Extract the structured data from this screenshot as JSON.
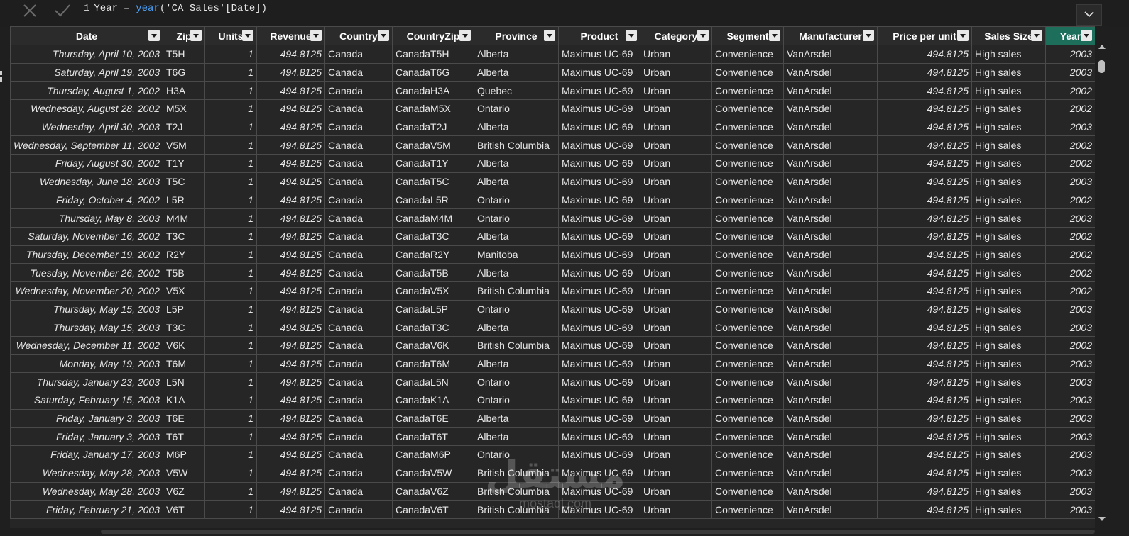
{
  "formula": {
    "line_number": "1",
    "prefix": "Year = ",
    "function": "year",
    "arg_open": "(",
    "argument": "'CA Sales'[Date]",
    "arg_close": ")"
  },
  "icons": {
    "cancel": "close-icon",
    "commit": "check-icon",
    "expand": "chevron-down-icon"
  },
  "colors": {
    "active_header": "#1e6e5c",
    "function_token": "#4aa3ff"
  },
  "watermark": {
    "big": "مستقل",
    "small": "mostaql.com"
  },
  "table": {
    "columns": [
      {
        "key": "date",
        "label": "Date",
        "align": "date"
      },
      {
        "key": "zip",
        "label": "Zip",
        "align": "txt"
      },
      {
        "key": "units",
        "label": "Units",
        "align": "num"
      },
      {
        "key": "revenue",
        "label": "Revenue",
        "align": "num"
      },
      {
        "key": "country",
        "label": "Country",
        "align": "txt"
      },
      {
        "key": "countryzip",
        "label": "CountryZip",
        "align": "txt"
      },
      {
        "key": "province",
        "label": "Province",
        "align": "txt"
      },
      {
        "key": "product",
        "label": "Product",
        "align": "txt"
      },
      {
        "key": "category",
        "label": "Category",
        "align": "txt"
      },
      {
        "key": "segment",
        "label": "Segment",
        "align": "txt"
      },
      {
        "key": "manufacturer",
        "label": "Manufacturer",
        "align": "txt"
      },
      {
        "key": "price",
        "label": "Price per unit",
        "align": "num"
      },
      {
        "key": "salessize",
        "label": "Sales Size",
        "align": "txt"
      },
      {
        "key": "year",
        "label": "Year",
        "align": "num",
        "active": true
      }
    ],
    "rows": [
      [
        "Thursday, April 10, 2003",
        "T5H",
        "1",
        "494.8125",
        "Canada",
        "CanadaT5H",
        "Alberta",
        "Maximus UC-69",
        "Urban",
        "Convenience",
        "VanArsdel",
        "494.8125",
        "High sales",
        "2003"
      ],
      [
        "Saturday, April 19, 2003",
        "T6G",
        "1",
        "494.8125",
        "Canada",
        "CanadaT6G",
        "Alberta",
        "Maximus UC-69",
        "Urban",
        "Convenience",
        "VanArsdel",
        "494.8125",
        "High sales",
        "2003"
      ],
      [
        "Thursday, August 1, 2002",
        "H3A",
        "1",
        "494.8125",
        "Canada",
        "CanadaH3A",
        "Quebec",
        "Maximus UC-69",
        "Urban",
        "Convenience",
        "VanArsdel",
        "494.8125",
        "High sales",
        "2002"
      ],
      [
        "Wednesday, August 28, 2002",
        "M5X",
        "1",
        "494.8125",
        "Canada",
        "CanadaM5X",
        "Ontario",
        "Maximus UC-69",
        "Urban",
        "Convenience",
        "VanArsdel",
        "494.8125",
        "High sales",
        "2002"
      ],
      [
        "Wednesday, April 30, 2003",
        "T2J",
        "1",
        "494.8125",
        "Canada",
        "CanadaT2J",
        "Alberta",
        "Maximus UC-69",
        "Urban",
        "Convenience",
        "VanArsdel",
        "494.8125",
        "High sales",
        "2003"
      ],
      [
        "Wednesday, September 11, 2002",
        "V5M",
        "1",
        "494.8125",
        "Canada",
        "CanadaV5M",
        "British Columbia",
        "Maximus UC-69",
        "Urban",
        "Convenience",
        "VanArsdel",
        "494.8125",
        "High sales",
        "2002"
      ],
      [
        "Friday, August 30, 2002",
        "T1Y",
        "1",
        "494.8125",
        "Canada",
        "CanadaT1Y",
        "Alberta",
        "Maximus UC-69",
        "Urban",
        "Convenience",
        "VanArsdel",
        "494.8125",
        "High sales",
        "2002"
      ],
      [
        "Wednesday, June 18, 2003",
        "T5C",
        "1",
        "494.8125",
        "Canada",
        "CanadaT5C",
        "Alberta",
        "Maximus UC-69",
        "Urban",
        "Convenience",
        "VanArsdel",
        "494.8125",
        "High sales",
        "2003"
      ],
      [
        "Friday, October 4, 2002",
        "L5R",
        "1",
        "494.8125",
        "Canada",
        "CanadaL5R",
        "Ontario",
        "Maximus UC-69",
        "Urban",
        "Convenience",
        "VanArsdel",
        "494.8125",
        "High sales",
        "2002"
      ],
      [
        "Thursday, May 8, 2003",
        "M4M",
        "1",
        "494.8125",
        "Canada",
        "CanadaM4M",
        "Ontario",
        "Maximus UC-69",
        "Urban",
        "Convenience",
        "VanArsdel",
        "494.8125",
        "High sales",
        "2003"
      ],
      [
        "Saturday, November 16, 2002",
        "T3C",
        "1",
        "494.8125",
        "Canada",
        "CanadaT3C",
        "Alberta",
        "Maximus UC-69",
        "Urban",
        "Convenience",
        "VanArsdel",
        "494.8125",
        "High sales",
        "2002"
      ],
      [
        "Thursday, December 19, 2002",
        "R2Y",
        "1",
        "494.8125",
        "Canada",
        "CanadaR2Y",
        "Manitoba",
        "Maximus UC-69",
        "Urban",
        "Convenience",
        "VanArsdel",
        "494.8125",
        "High sales",
        "2002"
      ],
      [
        "Tuesday, November 26, 2002",
        "T5B",
        "1",
        "494.8125",
        "Canada",
        "CanadaT5B",
        "Alberta",
        "Maximus UC-69",
        "Urban",
        "Convenience",
        "VanArsdel",
        "494.8125",
        "High sales",
        "2002"
      ],
      [
        "Wednesday, November 20, 2002",
        "V5X",
        "1",
        "494.8125",
        "Canada",
        "CanadaV5X",
        "British Columbia",
        "Maximus UC-69",
        "Urban",
        "Convenience",
        "VanArsdel",
        "494.8125",
        "High sales",
        "2002"
      ],
      [
        "Thursday, May 15, 2003",
        "L5P",
        "1",
        "494.8125",
        "Canada",
        "CanadaL5P",
        "Ontario",
        "Maximus UC-69",
        "Urban",
        "Convenience",
        "VanArsdel",
        "494.8125",
        "High sales",
        "2003"
      ],
      [
        "Thursday, May 15, 2003",
        "T3C",
        "1",
        "494.8125",
        "Canada",
        "CanadaT3C",
        "Alberta",
        "Maximus UC-69",
        "Urban",
        "Convenience",
        "VanArsdel",
        "494.8125",
        "High sales",
        "2003"
      ],
      [
        "Wednesday, December 11, 2002",
        "V6K",
        "1",
        "494.8125",
        "Canada",
        "CanadaV6K",
        "British Columbia",
        "Maximus UC-69",
        "Urban",
        "Convenience",
        "VanArsdel",
        "494.8125",
        "High sales",
        "2002"
      ],
      [
        "Monday, May 19, 2003",
        "T6M",
        "1",
        "494.8125",
        "Canada",
        "CanadaT6M",
        "Alberta",
        "Maximus UC-69",
        "Urban",
        "Convenience",
        "VanArsdel",
        "494.8125",
        "High sales",
        "2003"
      ],
      [
        "Thursday, January 23, 2003",
        "L5N",
        "1",
        "494.8125",
        "Canada",
        "CanadaL5N",
        "Ontario",
        "Maximus UC-69",
        "Urban",
        "Convenience",
        "VanArsdel",
        "494.8125",
        "High sales",
        "2003"
      ],
      [
        "Saturday, February 15, 2003",
        "K1A",
        "1",
        "494.8125",
        "Canada",
        "CanadaK1A",
        "Ontario",
        "Maximus UC-69",
        "Urban",
        "Convenience",
        "VanArsdel",
        "494.8125",
        "High sales",
        "2003"
      ],
      [
        "Friday, January 3, 2003",
        "T6E",
        "1",
        "494.8125",
        "Canada",
        "CanadaT6E",
        "Alberta",
        "Maximus UC-69",
        "Urban",
        "Convenience",
        "VanArsdel",
        "494.8125",
        "High sales",
        "2003"
      ],
      [
        "Friday, January 3, 2003",
        "T6T",
        "1",
        "494.8125",
        "Canada",
        "CanadaT6T",
        "Alberta",
        "Maximus UC-69",
        "Urban",
        "Convenience",
        "VanArsdel",
        "494.8125",
        "High sales",
        "2003"
      ],
      [
        "Friday, January 17, 2003",
        "M6P",
        "1",
        "494.8125",
        "Canada",
        "CanadaM6P",
        "Ontario",
        "Maximus UC-69",
        "Urban",
        "Convenience",
        "VanArsdel",
        "494.8125",
        "High sales",
        "2003"
      ],
      [
        "Wednesday, May 28, 2003",
        "V5W",
        "1",
        "494.8125",
        "Canada",
        "CanadaV5W",
        "British Columbia",
        "Maximus UC-69",
        "Urban",
        "Convenience",
        "VanArsdel",
        "494.8125",
        "High sales",
        "2003"
      ],
      [
        "Wednesday, May 28, 2003",
        "V6Z",
        "1",
        "494.8125",
        "Canada",
        "CanadaV6Z",
        "British Columbia",
        "Maximus UC-69",
        "Urban",
        "Convenience",
        "VanArsdel",
        "494.8125",
        "High sales",
        "2003"
      ],
      [
        "Friday, February 21, 2003",
        "V6T",
        "1",
        "494.8125",
        "Canada",
        "CanadaV6T",
        "British Columbia",
        "Maximus UC-69",
        "Urban",
        "Convenience",
        "VanArsdel",
        "494.8125",
        "High sales",
        "2003"
      ]
    ]
  }
}
